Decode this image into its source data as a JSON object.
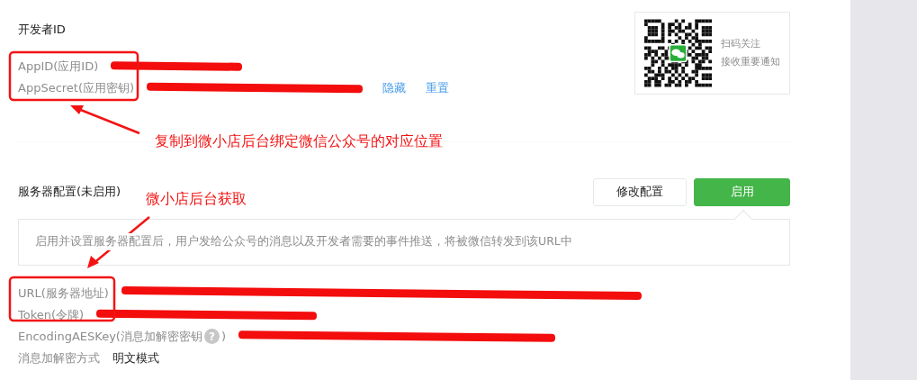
{
  "developer_id": {
    "title": "开发者ID",
    "fields": [
      {
        "label": "AppID(应用ID)",
        "redacted": true
      },
      {
        "label": "AppSecret(应用密钥)",
        "redacted": true,
        "links": [
          "隐藏",
          "重置"
        ]
      }
    ]
  },
  "qr_card": {
    "lines": [
      "扫码关注",
      "接收重要通知"
    ]
  },
  "server_config": {
    "title": "服务器配置(未启用)",
    "buttons": [
      {
        "label": "修改配置",
        "kind": "default"
      },
      {
        "label": "启用",
        "kind": "primary"
      }
    ],
    "notice": "启用并设置服务器配置后，用户发给公众号的消息以及开发者需要的事件推送，将被微信转发到该URL中",
    "fields": [
      {
        "label": "URL(服务器地址)",
        "redacted": true
      },
      {
        "label": "Token(令牌)",
        "redacted": true
      },
      {
        "label": "EncodingAESKey(消息加解密密钥",
        "help": "?",
        "label_end": ")",
        "redacted": true
      },
      {
        "label": "消息加解密方式",
        "value": "明文模式"
      }
    ]
  },
  "annotations": [
    {
      "text": "复制到微小店后台绑定微信公众号的对应位置"
    },
    {
      "text": "微小店后台获取"
    }
  ]
}
